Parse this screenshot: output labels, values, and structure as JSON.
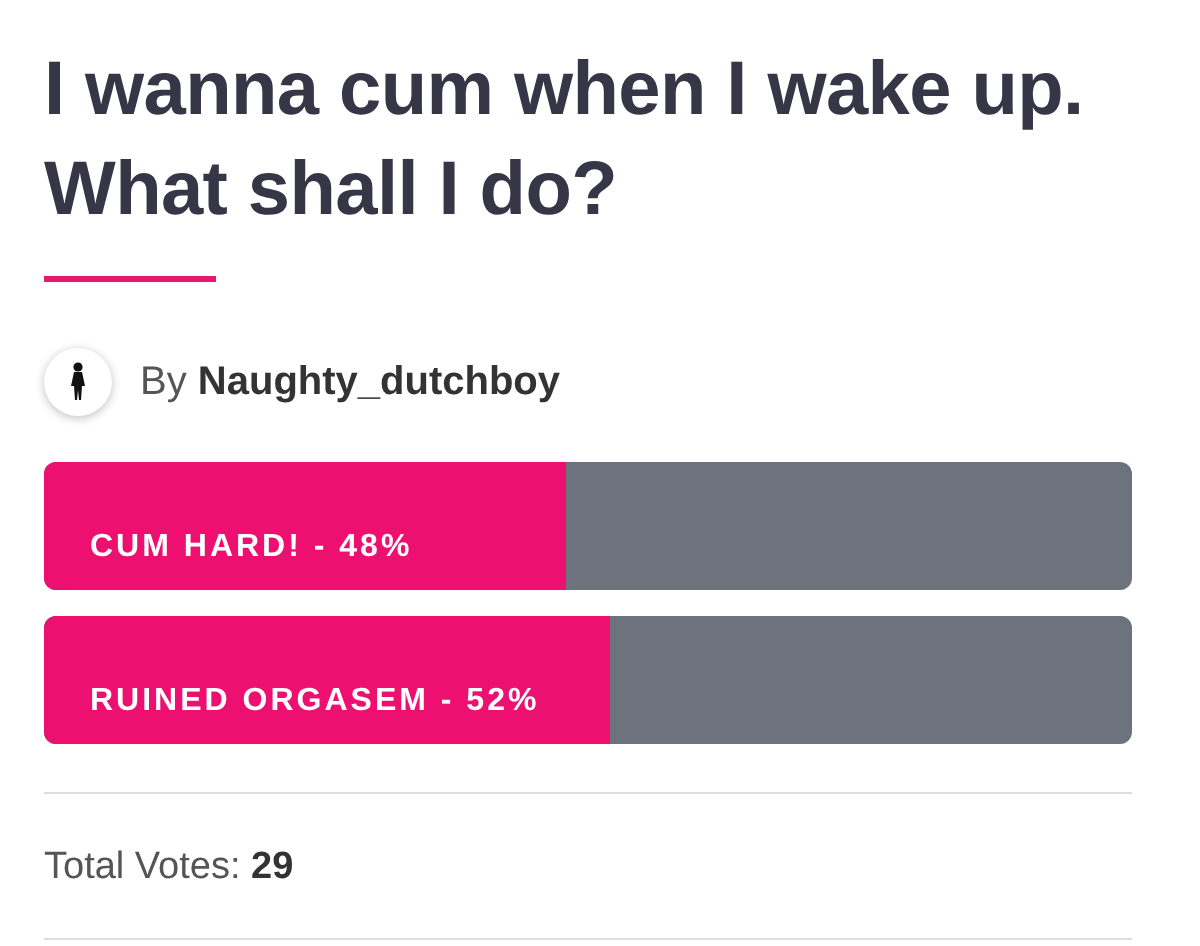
{
  "poll": {
    "title": "I wanna cum when I wake up. What shall I do?",
    "author": "By **Naughty_dutchboy**",
    "options": [
      {
        "label": "CUM HARD! - 48%",
        "level": 0.48
      },
      {
        "label": "RUINED ORGASEM - 52%",
        "level": 0.52
      }
    ],
    "total": "Total Votes: **29**"
  }
}
